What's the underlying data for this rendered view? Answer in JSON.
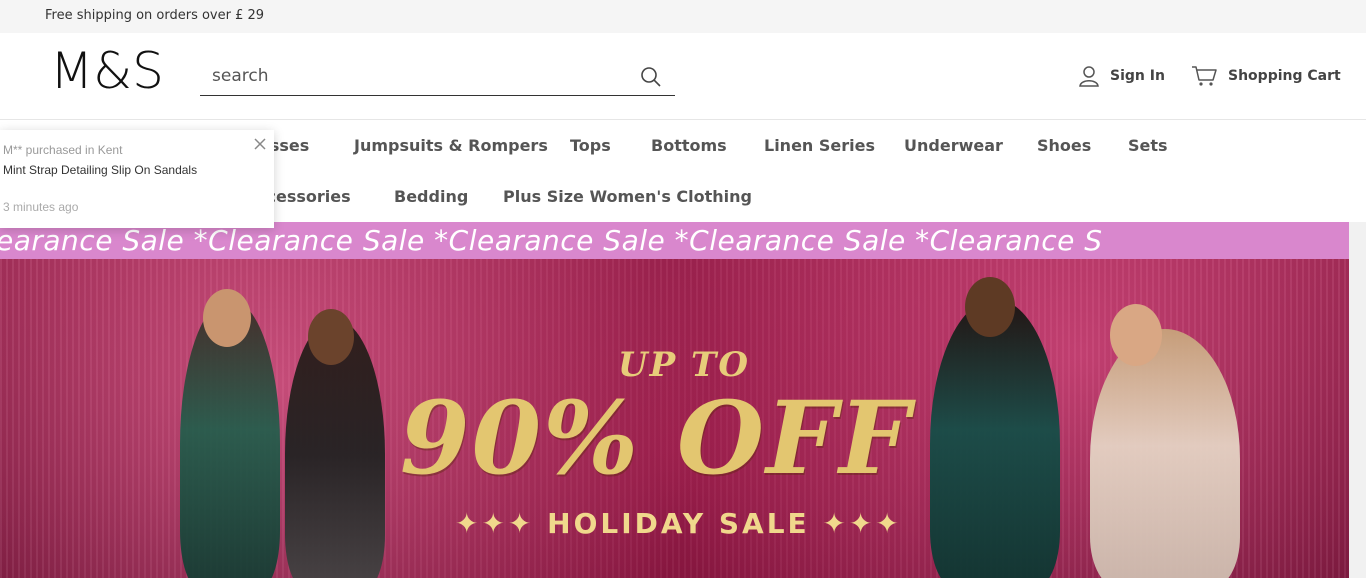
{
  "topbar": {
    "shipping_text": "Free shipping on orders over  £ 29"
  },
  "header": {
    "logo_text": "M&S",
    "search": {
      "placeholder": "search"
    },
    "signin_label": "Sign In",
    "cart_label": "Shopping Cart"
  },
  "nav": {
    "row1": [
      "esses",
      "Jumpsuits & Rompers",
      "Tops",
      "Bottoms",
      "Linen Series",
      "Underwear",
      "Shoes",
      "Sets"
    ],
    "row2": [
      "ccessories",
      "Bedding",
      "Plus Size Women's Clothing"
    ]
  },
  "toast": {
    "buyer": "M** purchased in Kent",
    "product": "Mint Strap Detailing Slip On Sandals",
    "time": "3 minutes ago"
  },
  "banner": {
    "marquee_text": "earance Sale   *Clearance Sale   *Clearance Sale   *Clearance Sale   *Clearance S",
    "up_to": "UP TO",
    "discount": "90% OFF",
    "sale_text": "✦✦✦ HOLIDAY SALE ✦✦✦"
  },
  "colors": {
    "marquee_bg": "#d987cd",
    "gold": "#e3c670",
    "banner_bg": "#7a1a3b"
  }
}
